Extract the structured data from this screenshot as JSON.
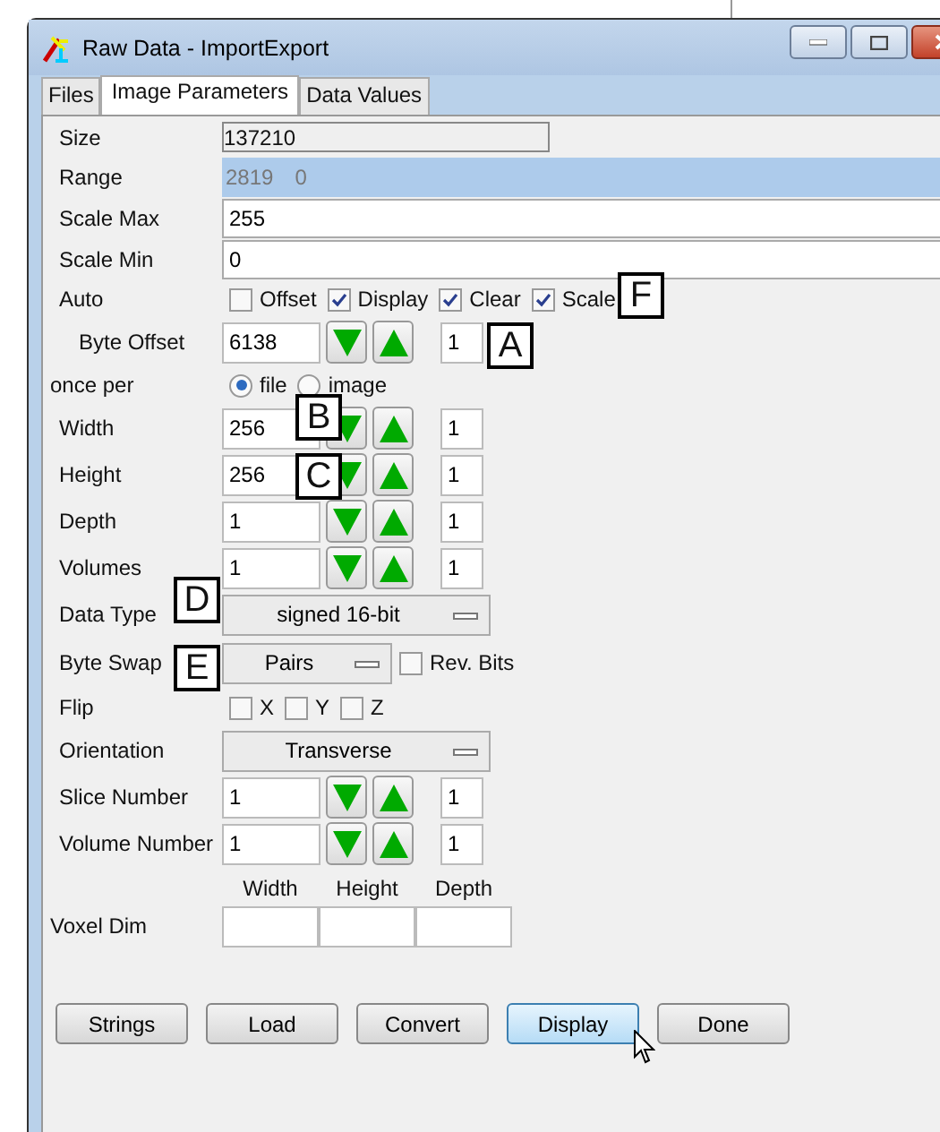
{
  "window": {
    "title": "Raw Data - ImportExport"
  },
  "tabs": [
    {
      "label": "Files",
      "selected": false
    },
    {
      "label": "Image Parameters",
      "selected": true
    },
    {
      "label": "Data Values",
      "selected": false
    }
  ],
  "rows": [
    {
      "kind": "readonly",
      "label": "Size",
      "value": "137210"
    },
    {
      "kind": "range",
      "label": "Range",
      "values": [
        "2819",
        "0"
      ]
    },
    {
      "kind": "text",
      "label": "Scale Max",
      "value": "255"
    },
    {
      "kind": "text",
      "label": "Scale Min",
      "value": "0"
    },
    {
      "kind": "checks",
      "label": "Auto",
      "options": [
        {
          "label": "Offset",
          "checked": false
        },
        {
          "label": "Display",
          "checked": true
        },
        {
          "label": "Clear",
          "checked": true
        },
        {
          "label": "Scale",
          "checked": true
        }
      ]
    },
    {
      "kind": "spinner",
      "label": "Byte Offset",
      "value": "6138",
      "step": "1"
    },
    {
      "kind": "radio",
      "label": "once per",
      "options": [
        {
          "label": "file",
          "selected": true
        },
        {
          "label": "image",
          "selected": false
        }
      ]
    },
    {
      "kind": "spinner",
      "label": "Width",
      "value": "256",
      "step": "1"
    },
    {
      "kind": "spinner",
      "label": "Height",
      "value": "256",
      "step": "1"
    },
    {
      "kind": "spinner",
      "label": "Depth",
      "value": "1",
      "step": "1"
    },
    {
      "kind": "spinner",
      "label": "Volumes",
      "value": "1",
      "step": "1"
    },
    {
      "kind": "dropdown",
      "label": "Data Type",
      "value": "signed 16-bit"
    },
    {
      "kind": "dropdown_check",
      "label": "Byte Swap",
      "value": "Pairs",
      "check": {
        "label": "Rev. Bits",
        "checked": false
      }
    },
    {
      "kind": "checks",
      "label": "Flip",
      "options": [
        {
          "label": "X",
          "checked": false
        },
        {
          "label": "Y",
          "checked": false
        },
        {
          "label": "Z",
          "checked": false
        }
      ]
    },
    {
      "kind": "dropdown",
      "label": "Orientation",
      "value": "Transverse"
    },
    {
      "kind": "spinner",
      "label": "Slice Number",
      "value": "1",
      "step": "1"
    },
    {
      "kind": "spinner",
      "label": "Volume Number",
      "value": "1",
      "step": "1"
    },
    {
      "kind": "voxel",
      "label": "Voxel Dim",
      "columns": [
        "Width",
        "Height",
        "Depth"
      ]
    }
  ],
  "buttons": [
    {
      "label": "Strings",
      "hovered": false
    },
    {
      "label": "Load",
      "hovered": false
    },
    {
      "label": "Convert",
      "hovered": false
    },
    {
      "label": "Display",
      "hovered": true
    },
    {
      "label": "Done",
      "hovered": false
    }
  ],
  "callouts": [
    "A",
    "B",
    "C",
    "D",
    "E",
    "F"
  ]
}
